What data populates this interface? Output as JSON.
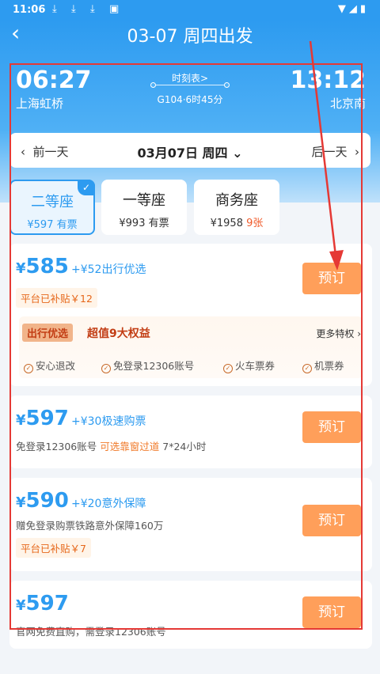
{
  "status": {
    "time": "11:06",
    "icons": "wifi-signal-battery"
  },
  "header": {
    "title": "03-07 周四出发",
    "back_icon": "chevron-left-icon"
  },
  "route": {
    "dep_time": "06:27",
    "dep_station": "上海虹桥",
    "arr_time": "13:12",
    "arr_station": "北京南",
    "schedule_link": "时刻表>",
    "train_info": "G104·6时45分"
  },
  "date_bar": {
    "prev": "前一天",
    "current": "03月07日 周四",
    "next": "后一天"
  },
  "seats": [
    {
      "name": "二等座",
      "price": "¥597",
      "avail": "有票",
      "selected": true
    },
    {
      "name": "一等座",
      "price": "¥993",
      "avail": "有票"
    },
    {
      "name": "商务座",
      "price": "¥1958",
      "avail": "9张"
    }
  ],
  "tickets": [
    {
      "price": "585",
      "addon": "+¥52出行优选",
      "subsidy": "平台已补贴￥12",
      "book": "预订"
    },
    {
      "price": "597",
      "addon": "+¥30极速购票",
      "desc_a": "免登录12306账号",
      "desc_b": "可选靠窗过道",
      "desc_c": "7*24小时",
      "book": "预订"
    },
    {
      "price": "590",
      "addon": "+¥20意外保障",
      "desc": "赠免登录购票铁路意外保障160万",
      "subsidy": "平台已补贴￥7",
      "book": "预订"
    },
    {
      "price": "597",
      "desc": "官网免费直购，需登录12306账号",
      "book": "预订"
    }
  ],
  "perks": {
    "tag": "出行优选",
    "title": "超值9大权益",
    "more": "更多特权",
    "items": [
      "安心退改",
      "免登录12306账号",
      "火车票券",
      "机票券"
    ]
  },
  "currency": "¥",
  "colors": {
    "primary": "#2d9bf0",
    "book": "#ff9f5a",
    "annotation": "#e53935"
  }
}
